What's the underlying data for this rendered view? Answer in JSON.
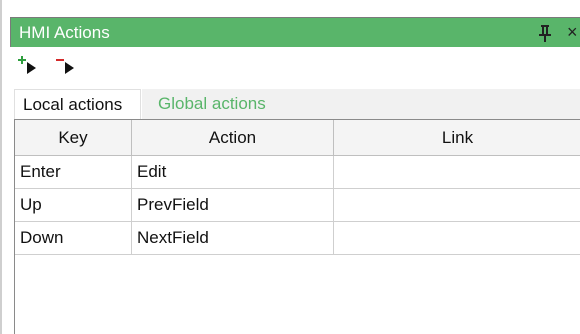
{
  "window": {
    "title": "HMI Actions",
    "pin_icon": "pin-icon",
    "close_glyph": "×",
    "title_bar_color": "#59b56a"
  },
  "toolbar": {
    "add_action_icon": "add-action-icon",
    "remove_action_icon": "remove-action-icon"
  },
  "tabs": [
    {
      "label": "Local actions",
      "active": true
    },
    {
      "label": "Global actions",
      "active": false
    }
  ],
  "table": {
    "columns": [
      "Key",
      "Action",
      "Link"
    ],
    "rows": [
      {
        "key": "Enter",
        "action": "Edit",
        "link": ""
      },
      {
        "key": "Up",
        "action": "PrevField",
        "link": ""
      },
      {
        "key": "Down",
        "action": "NextField",
        "link": ""
      }
    ]
  },
  "colors": {
    "accent_green": "#59b56a",
    "add_green": "#2e9e3e",
    "remove_red": "#d42a2a"
  }
}
